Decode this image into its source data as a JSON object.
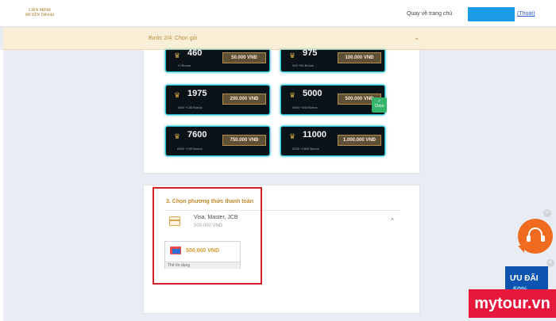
{
  "header": {
    "logo_lines": [
      "LIÊN MINH",
      "HUYỀN THOẠI"
    ],
    "home_link": "Quay về trang chủ",
    "logout": "(Thoát)"
  },
  "step": {
    "label": "Bước 2/4: Chọn gói",
    "chevron": "⌄"
  },
  "packages": [
    {
      "amount": "460",
      "sub": "+0 Bonus",
      "price": "50.000 VNĐ",
      "selected": false
    },
    {
      "amount": "975",
      "sub": "900 +65 Bonus",
      "price": "100.000 VNĐ",
      "selected": false
    },
    {
      "amount": "1975",
      "sub": "1840 +135 Bonus",
      "price": "200.000 VNĐ",
      "selected": false
    },
    {
      "amount": "5000",
      "sub": "4600 +400 Bonus",
      "price": "500.000 VNĐ",
      "selected": true
    },
    {
      "amount": "7600",
      "sub": "6900 +700 Bonus",
      "price": "750.000 VNĐ",
      "selected": false
    },
    {
      "amount": "11000",
      "sub": "9200 +1800 Bonus",
      "price": "1.000.000 VNĐ",
      "selected": false
    }
  ],
  "selected_badge": {
    "check": "✓",
    "label": "Chọn"
  },
  "payment": {
    "title": "3. Chọn phương thức thanh toán",
    "method_name": "Visa, Master, JCB",
    "method_amount": "500,000 VND",
    "method_chevron": "^",
    "card_price": "500,000 VND",
    "card_footer": "Thẻ tín dụng"
  },
  "widgets": {
    "close": "×",
    "promo_title": "ƯU ĐÃI",
    "promo_pct": "50%"
  },
  "watermark": "mytour.vn",
  "colors": {
    "accent_gold": "#c28a2b",
    "step_bar": "#f9eed6",
    "pack_border": "#12c0d1",
    "highlight_red": "#d42028",
    "selected_green": "#35b56b",
    "support_orange": "#f06a1f",
    "watermark_red": "#e8183d"
  }
}
